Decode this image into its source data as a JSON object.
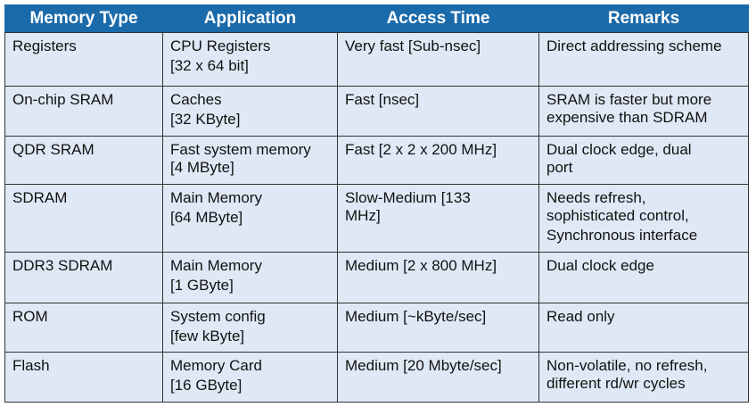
{
  "table": {
    "headers": [
      "Memory Type",
      "Application",
      "Access Time",
      "Remarks"
    ],
    "rows": [
      {
        "type": "Registers",
        "application": [
          "CPU Registers",
          "[32 x 64 bit]"
        ],
        "access": "Very fast [Sub-nsec]",
        "remarks": [
          "Direct addressing scheme"
        ]
      },
      {
        "type": "On-chip SRAM",
        "application": [
          "Caches",
          "[32 KByte]"
        ],
        "access": "Fast [nsec]",
        "remarks": [
          "SRAM is faster but more",
          "expensive than SDRAM"
        ]
      },
      {
        "type": "QDR SRAM",
        "application": [
          "Fast system memory",
          "[4 MByte]"
        ],
        "access": "Fast [2 x 2 x 200 MHz]",
        "remarks": [
          "Dual clock edge, dual",
          "port"
        ]
      },
      {
        "type": "SDRAM",
        "application": [
          "Main Memory",
          "[64 MByte]"
        ],
        "access": "Slow-Medium [133 MHz]",
        "remarks": [
          "Needs refresh,",
          "sophisticated control,",
          "Synchronous interface"
        ]
      },
      {
        "type": "DDR3 SDRAM",
        "application": [
          "Main Memory",
          "[1 GByte]"
        ],
        "access": "Medium [2 x 800 MHz]",
        "remarks": [
          "Dual clock edge"
        ]
      },
      {
        "type": "ROM",
        "application": [
          "System config",
          "[few kByte]"
        ],
        "access": "Medium [~kByte/sec]",
        "remarks": [
          "Read only"
        ]
      },
      {
        "type": "Flash",
        "application": [
          "Memory Card",
          "[16 GByte]"
        ],
        "access": "Medium [20 Mbyte/sec]",
        "remarks": [
          "Non-volatile, no refresh,",
          "different rd/wr cycles"
        ]
      }
    ]
  },
  "colors": {
    "header_bg": "#1b6aaa",
    "cell_bg": "#dfe9f5",
    "border": "#333333"
  }
}
